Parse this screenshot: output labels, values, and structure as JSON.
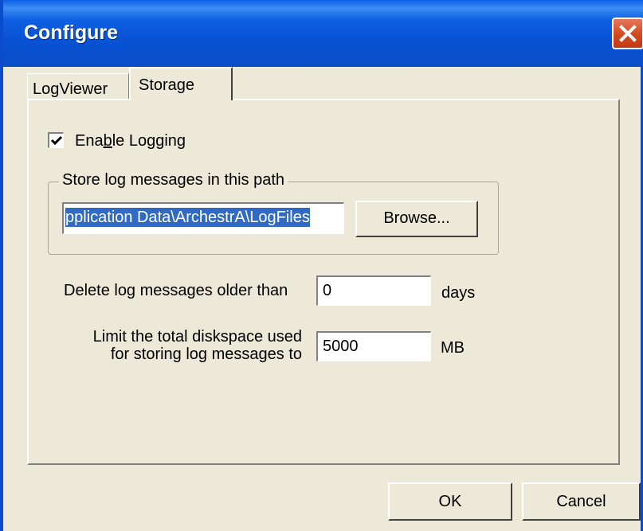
{
  "window": {
    "title": "Configure"
  },
  "tabs": [
    {
      "label": "LogViewer",
      "selected": false
    },
    {
      "label": "Storage",
      "selected": true
    }
  ],
  "storage": {
    "enable_logging": {
      "label_prefix": "Ena",
      "label_mnemonic": "b",
      "label_suffix": "le Logging",
      "checked": true
    },
    "group_title": "Store log messages in this path",
    "path_value": "pplication Data\\ArchestrA\\LogFiles",
    "browse_label": "Browse...",
    "delete_label": "Delete log messages older than",
    "delete_value": "0",
    "delete_unit": "days",
    "limit_label_line1": "Limit the total diskspace used",
    "limit_label_line2": "for storing log messages to",
    "limit_value": "5000",
    "limit_unit": "MB"
  },
  "footer": {
    "ok_label": "OK",
    "cancel_label": "Cancel"
  },
  "colors": {
    "titlebar": "#0a5fe5",
    "selection": "#316ac5",
    "close_button": "#d3491f",
    "dialog_bg": "#ece9d8"
  },
  "icons": {
    "close": "close-icon",
    "check": "checkmark-icon"
  }
}
